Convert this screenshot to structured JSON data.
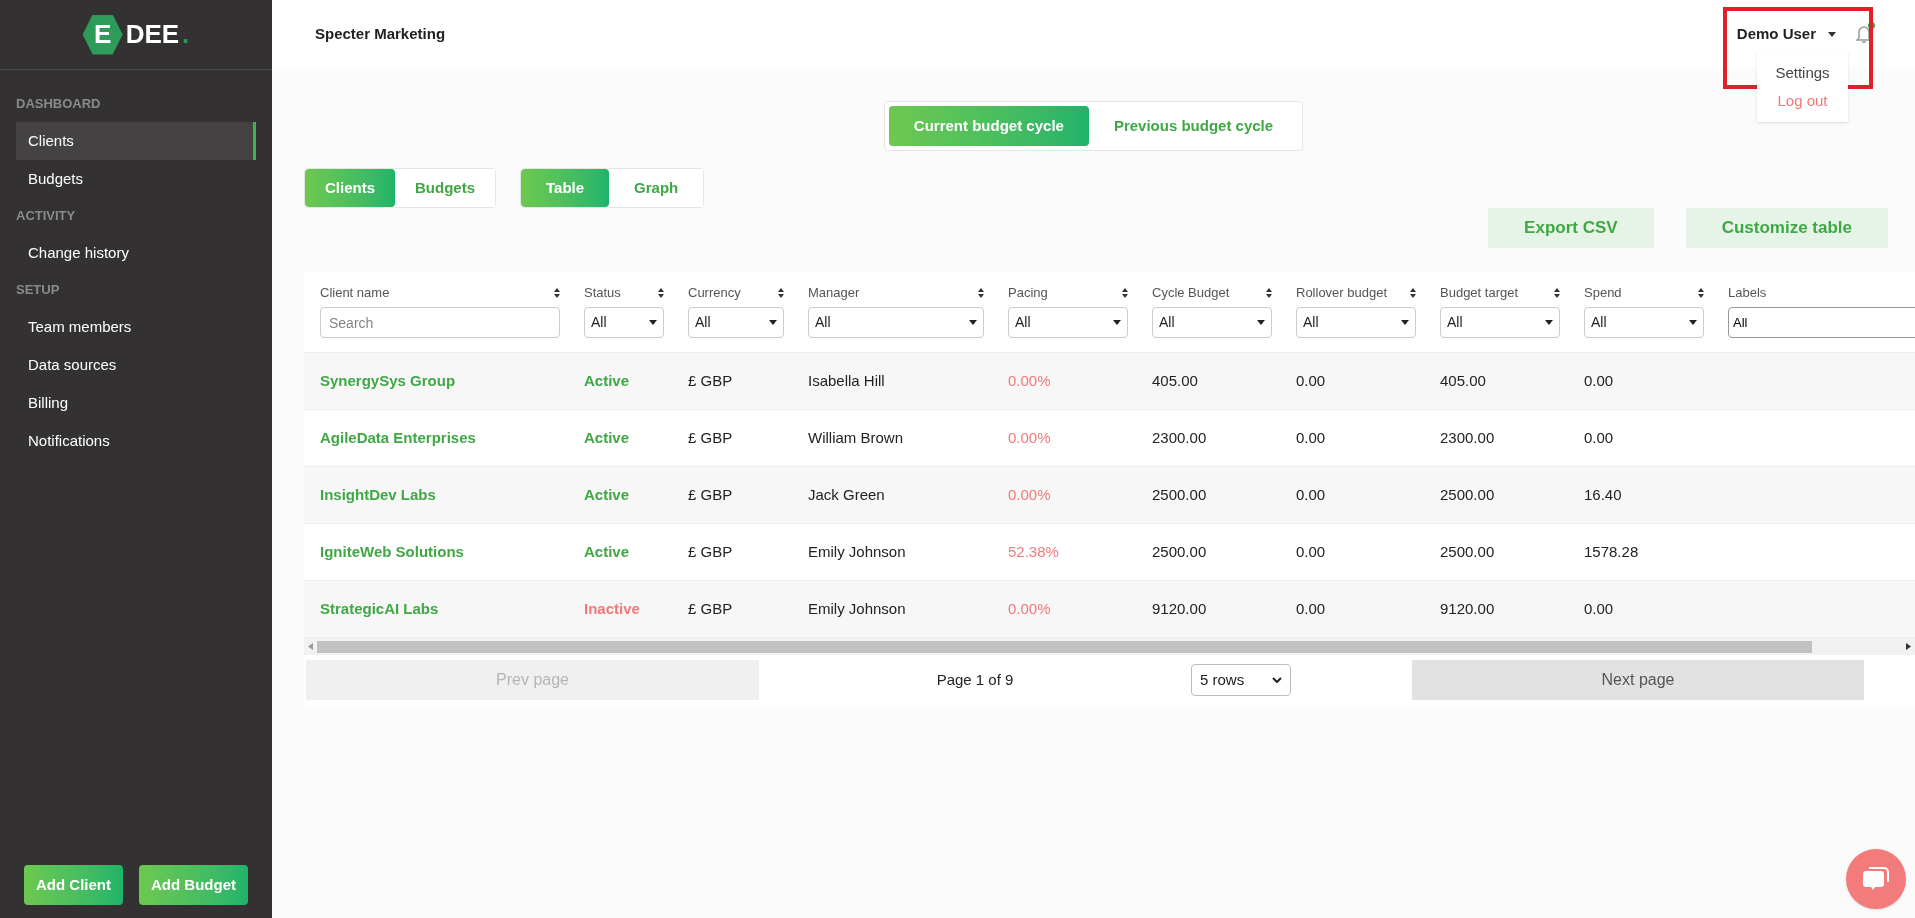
{
  "logo": {
    "mark": "E",
    "text": "DEE",
    "dot": "."
  },
  "sidebar": {
    "sections": [
      {
        "heading": "DASHBOARD",
        "items": [
          {
            "label": "Clients",
            "selected": true
          },
          {
            "label": "Budgets",
            "selected": false
          }
        ]
      },
      {
        "heading": "ACTIVITY",
        "items": [
          {
            "label": "Change history",
            "selected": false
          }
        ]
      },
      {
        "heading": "SETUP",
        "items": [
          {
            "label": "Team members",
            "selected": false
          },
          {
            "label": "Data sources",
            "selected": false
          },
          {
            "label": "Billing",
            "selected": false
          },
          {
            "label": "Notifications",
            "selected": false
          }
        ]
      }
    ],
    "buttons": [
      "Add Client",
      "Add Budget"
    ]
  },
  "header": {
    "title": "Specter Marketing",
    "user": "Demo User",
    "notification_dot": true,
    "user_menu": [
      {
        "label": "Settings",
        "kind": "normal"
      },
      {
        "label": "Log out",
        "kind": "danger"
      }
    ]
  },
  "cycle_tabs": [
    {
      "label": "Current budget cycle",
      "selected": true
    },
    {
      "label": "Previous budget cycle",
      "selected": false
    }
  ],
  "entity_tabs": [
    {
      "label": "Clients",
      "selected": true
    },
    {
      "label": "Budgets",
      "selected": false
    }
  ],
  "view_tabs": [
    {
      "label": "Table",
      "selected": true
    },
    {
      "label": "Graph",
      "selected": false
    }
  ],
  "actions": [
    "Export CSV",
    "Customize table"
  ],
  "table": {
    "columns": [
      {
        "label": "Client name",
        "sortable": true,
        "filter": {
          "kind": "search",
          "placeholder": "Search"
        }
      },
      {
        "label": "Status",
        "sortable": true,
        "filter": {
          "kind": "select",
          "value": "All"
        }
      },
      {
        "label": "Currency",
        "sortable": true,
        "filter": {
          "kind": "select",
          "value": "All"
        }
      },
      {
        "label": "Manager",
        "sortable": true,
        "filter": {
          "kind": "select",
          "value": "All"
        }
      },
      {
        "label": "Pacing",
        "sortable": true,
        "filter": {
          "kind": "select",
          "value": "All"
        }
      },
      {
        "label": "Cycle Budget",
        "sortable": true,
        "filter": {
          "kind": "select",
          "value": "All"
        }
      },
      {
        "label": "Rollover budget",
        "sortable": true,
        "filter": {
          "kind": "select",
          "value": "All"
        }
      },
      {
        "label": "Budget target",
        "sortable": true,
        "filter": {
          "kind": "select",
          "value": "All"
        }
      },
      {
        "label": "Spend",
        "sortable": true,
        "filter": {
          "kind": "select",
          "value": "All"
        }
      },
      {
        "label": "Labels",
        "sortable": false,
        "filter": {
          "kind": "text",
          "value": "All"
        }
      }
    ],
    "rows": [
      {
        "inactive": false,
        "cells": [
          "SynergySys Group",
          "Active",
          "£ GBP",
          "Isabella Hill",
          "0.00%",
          "405.00",
          "0.00",
          "405.00",
          "0.00"
        ]
      },
      {
        "inactive": false,
        "cells": [
          "AgileData Enterprises",
          "Active",
          "£ GBP",
          "William Brown",
          "0.00%",
          "2300.00",
          "0.00",
          "2300.00",
          "0.00"
        ]
      },
      {
        "inactive": false,
        "cells": [
          "InsightDev Labs",
          "Active",
          "£ GBP",
          "Jack Green",
          "0.00%",
          "2500.00",
          "0.00",
          "2500.00",
          "16.40"
        ]
      },
      {
        "inactive": false,
        "cells": [
          "IgniteWeb Solutions",
          "Active",
          "£ GBP",
          "Emily Johnson",
          "52.38%",
          "2500.00",
          "0.00",
          "2500.00",
          "1578.28"
        ]
      },
      {
        "inactive": true,
        "cells": [
          "StrategicAI Labs",
          "Inactive",
          "£ GBP",
          "Emily Johnson",
          "0.00%",
          "9120.00",
          "0.00",
          "9120.00",
          "0.00"
        ]
      }
    ]
  },
  "pagination": {
    "prev": {
      "label": "Prev page",
      "disabled": true
    },
    "page": "Page 1 of 9",
    "rows_per_page": "5 rows",
    "next": {
      "label": "Next page",
      "disabled": false
    }
  }
}
